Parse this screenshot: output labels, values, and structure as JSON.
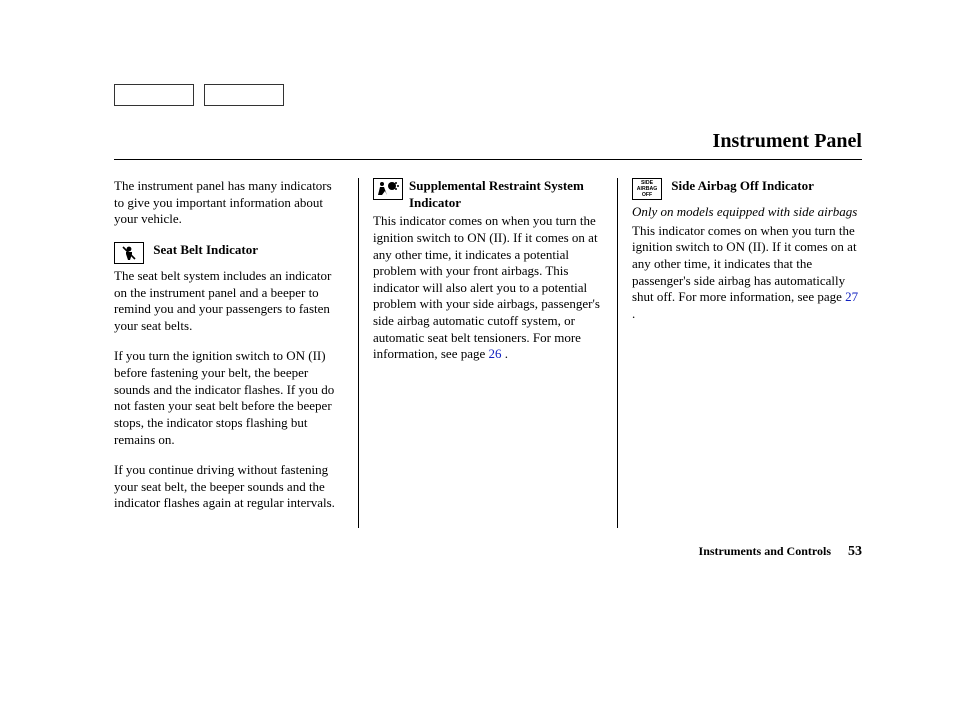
{
  "buttons": {
    "b1": "",
    "b2": ""
  },
  "title": "Instrument Panel",
  "col1": {
    "intro": "The instrument panel has many indicators to give you important information about your vehicle.",
    "h1": "Seat Belt Indicator",
    "icon1_name": "seatbelt-icon",
    "p1": "The seat belt system includes an indicator on the instrument panel and a beeper to remind you and your passengers to fasten your seat belts.",
    "p2": "If you turn the ignition switch to ON (II) before fastening your belt, the beeper sounds and the indicator flashes. If you do not fasten your seat belt before the beeper stops, the indicator stops flashing but remains on.",
    "p3": "If you continue driving without fastening your seat belt, the beeper sounds and the indicator flashes again at regular intervals."
  },
  "col2": {
    "h1": "Supplemental Restraint System Indicator",
    "icon1_name": "srs-airbag-icon",
    "p1a": "This indicator comes on when you turn the ignition switch to ON (II). If it comes on at any other time, it indicates a potential problem with your front airbags. This indicator will also alert you to a potential problem with your side airbags, passenger's side airbag automatic cutoff system, or automatic seat belt tensioners. For more information, see page ",
    "ref1": "26",
    "p1b": " ."
  },
  "col3": {
    "h1": "Side Airbag Off Indicator",
    "icon1_name": "side-airbag-off-icon",
    "icon1_text": "SIDE AIRBAG OFF",
    "note": "Only on models equipped with side airbags",
    "p1a": "This indicator comes on when you turn the ignition switch to ON (II). If it comes on at any other time, it indicates that the passenger's side airbag has automatically shut off. For more information, see page ",
    "ref1": "27",
    "p1b": " ."
  },
  "footer": {
    "section": "Instruments and Controls",
    "page": "53"
  }
}
